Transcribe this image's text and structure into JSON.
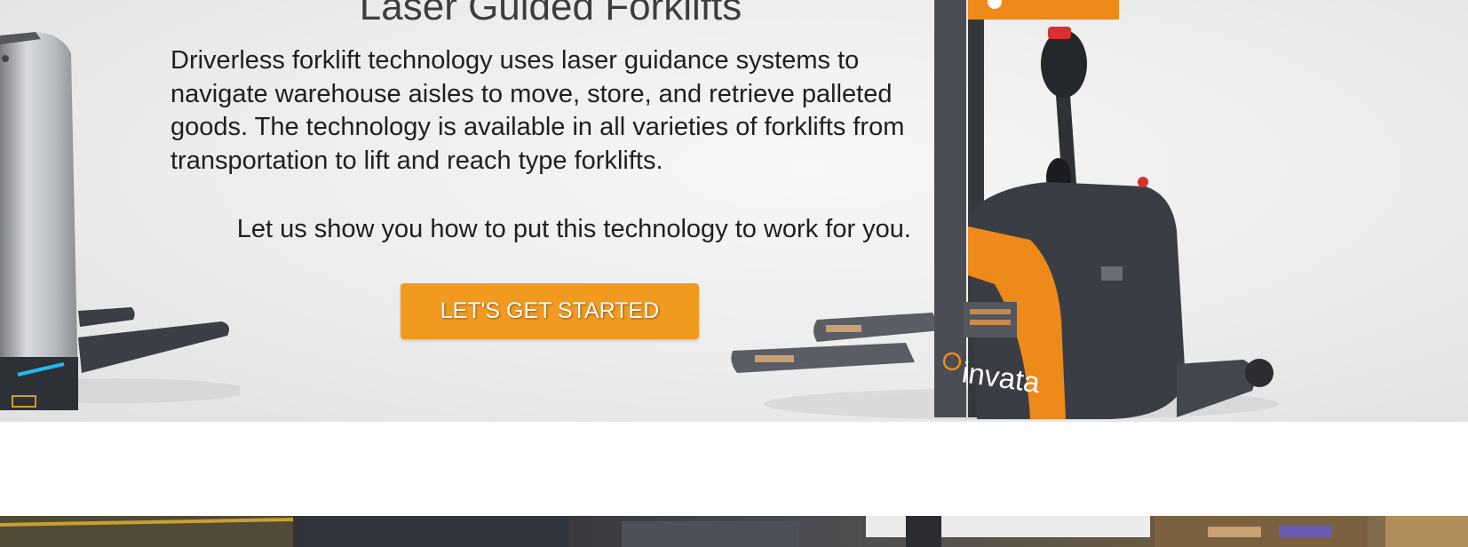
{
  "hero": {
    "title": "Laser Guided Forklifts",
    "description": "Driverless forklift technology uses laser guidance systems to navigate warehouse aisles to move, store, and retrieve palleted goods. The technology is available in all varieties of forklifts from transportation to lift and reach type forklifts.",
    "cta_text": "Let us show you how to put this technology to work for you.",
    "cta_button_label": "LET'S GET STARTED",
    "brand_logo_text": "invata"
  },
  "colors": {
    "accent": "#f29a20",
    "text": "#1f1f1f",
    "title": "#3d3d3d",
    "forklift_orange": "#ee8a1a",
    "forklift_dark": "#3a3d44"
  },
  "images": {
    "left_forklift": "silver-autonomous-forklift",
    "right_forklift": "orange-invata-laser-guided-forklift",
    "bottom_strip": "warehouse-interior-photo"
  }
}
